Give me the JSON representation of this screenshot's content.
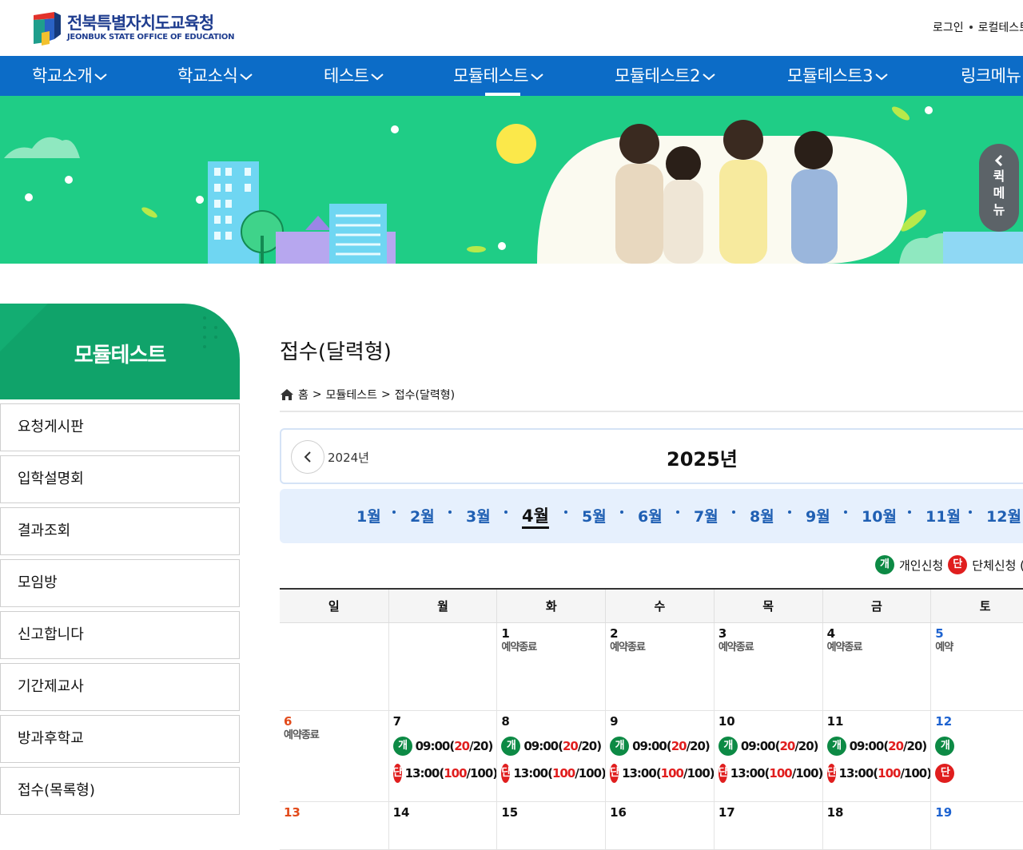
{
  "header": {
    "logo_title": "전북특별자치도교육청",
    "logo_sub": "JEONBUK STATE OFFICE OF EDUCATION",
    "util_login": "로그인",
    "util_local": "로컬테스트"
  },
  "gnb": [
    {
      "label": "학교소개"
    },
    {
      "label": "학교소식"
    },
    {
      "label": "테스트"
    },
    {
      "label": "모듈테스트"
    },
    {
      "label": "모듈테스트2"
    },
    {
      "label": "모듈테스트3"
    },
    {
      "label": "링크메뉴"
    }
  ],
  "quick_menu": [
    "퀵",
    "메",
    "뉴"
  ],
  "lnb": {
    "title": "모듈테스트",
    "items": [
      "요청게시판",
      "입학설명회",
      "결과조회",
      "모임방",
      "신고합니다",
      "기간제교사",
      "방과후학교",
      "접수(목록형)"
    ]
  },
  "content": {
    "title": "접수(달력형)",
    "breadcrumb": [
      "홈",
      "모듈테스트",
      "접수(달력형)"
    ],
    "prev_year": "2024년",
    "current_year": "2025년",
    "months": [
      "1월",
      "2월",
      "3월",
      "4월",
      "5월",
      "6월",
      "7월",
      "8월",
      "9월",
      "10월",
      "11월",
      "12월"
    ],
    "active_month": "4월",
    "legend": {
      "individual_badge": "개",
      "individual_label": "개인신청",
      "group_badge": "단",
      "group_label": "단체신청 ("
    },
    "weekdays": [
      "일",
      "월",
      "화",
      "수",
      "목",
      "금",
      "토"
    ],
    "closed_text": "예약종료",
    "slot_individual": {
      "badge": "개",
      "time": "09:00",
      "open": "(",
      "booked": "20",
      "total": "/20)"
    },
    "slot_group": {
      "badge": "단",
      "time": "13:00",
      "open": "(",
      "booked": "100",
      "total": "/100)"
    },
    "week1_days": [
      "",
      "",
      "1",
      "2",
      "3",
      "4",
      "5"
    ],
    "week2_days": [
      "6",
      "7",
      "8",
      "9",
      "10",
      "11",
      "12"
    ],
    "week3_days": [
      "13",
      "14",
      "15",
      "16",
      "17",
      "18",
      "19"
    ],
    "week1_status_partial": "예약"
  },
  "colors": {
    "nav": "#0c6cc7",
    "banner": "#1fcd86",
    "lnb": "#10a36a",
    "individual": "#0d8a45",
    "group": "#e01e1e"
  }
}
